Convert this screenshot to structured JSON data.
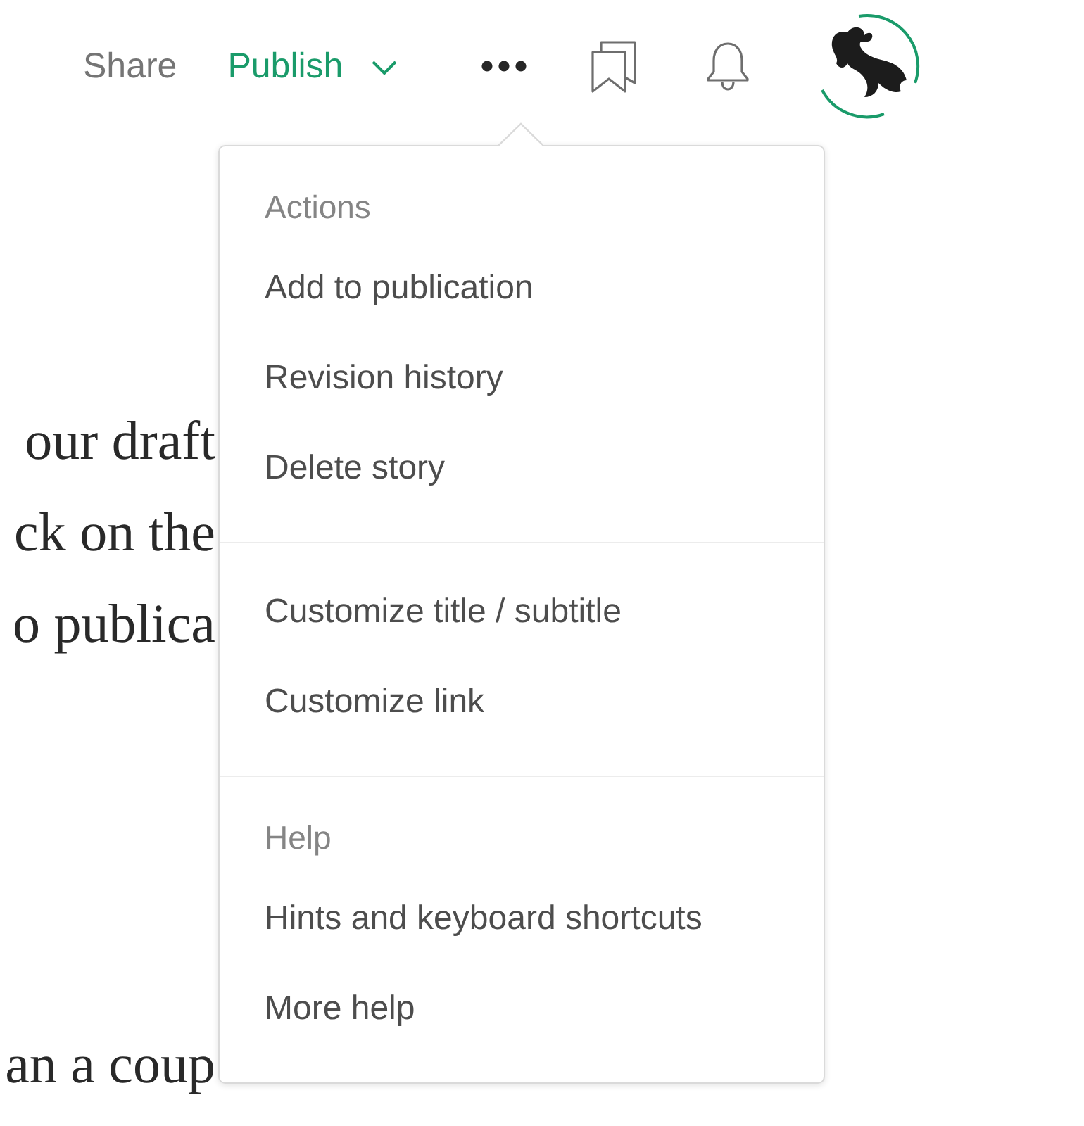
{
  "toolbar": {
    "share": "Share",
    "publish": "Publish"
  },
  "article": {
    "paragraphs": [
      [
        "our draft",
        "ck on the",
        "o publica"
      ],
      [
        "an a coup"
      ]
    ]
  },
  "menu": {
    "sections": [
      {
        "heading": "Actions",
        "items": [
          "Add to publication",
          "Revision history",
          "Delete story"
        ]
      },
      {
        "items": [
          "Customize title / subtitle",
          "Customize link"
        ]
      },
      {
        "heading": "Help",
        "items": [
          "Hints and keyboard shortcuts",
          "More help"
        ]
      }
    ]
  }
}
